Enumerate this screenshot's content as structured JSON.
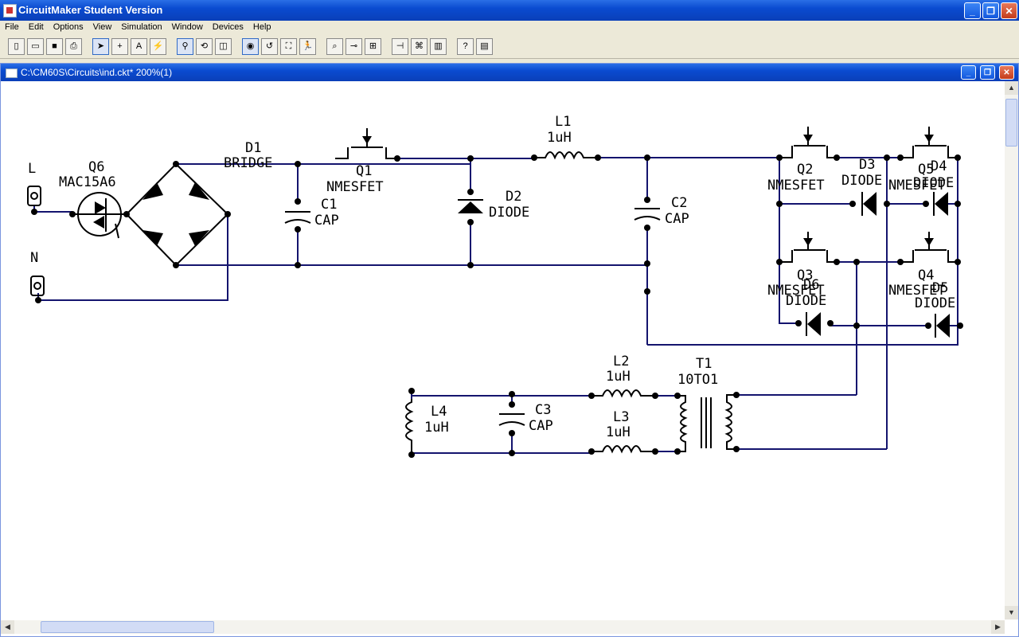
{
  "app": {
    "title": "CircuitMaker Student Version"
  },
  "menu": [
    "File",
    "Edit",
    "Options",
    "View",
    "Simulation",
    "Window",
    "Devices",
    "Help"
  ],
  "toolbar": {
    "icons": [
      "new-file-icon",
      "open-folder-icon",
      "save-icon",
      "print-icon",
      "arrow-tool-icon",
      "wire-tool-icon",
      "text-tool-icon",
      "probe-tool-icon",
      "zoom-icon",
      "rotate-icon",
      "mirror-icon",
      "simulate-icon",
      "undo-icon",
      "step-icon",
      "run-icon",
      "probe-icon",
      "scope-icon",
      "graph-icon",
      "component-icon",
      "search-icon",
      "paste-icon",
      "help-icon",
      "settings-icon"
    ]
  },
  "document": {
    "title": "C:\\CM60S\\Circuits\\ind.ckt* 200%(1)"
  },
  "schematic": {
    "labels": {
      "L": "L",
      "N": "N",
      "Q6_name": "Q6",
      "Q6_part": "MAC15A6",
      "D1_name": "D1",
      "D1_part": "BRIDGE",
      "C1_name": "C1",
      "C1_part": "CAP",
      "Q1_name": "Q1",
      "Q1_part": "NMESFET",
      "D2_name": "D2",
      "D2_part": "DIODE",
      "L1_name": "L1",
      "L1_val": "1uH",
      "C2_name": "C2",
      "C2_part": "CAP",
      "Q2_name": "Q2",
      "Q2_part": "NMESFET",
      "D3_name": "D3",
      "D3_part": "DIODE",
      "Q5_name": "Q5",
      "Q5_part": "NMESFET",
      "D4_name": "D4",
      "D4_part": "DIODE",
      "Q3_name": "Q3",
      "Q3_part": "NMESFET",
      "D6_name": "D6",
      "D6_part": "DIODE",
      "Q4_name": "Q4",
      "Q4_part": "NMESFET",
      "D5_name": "D5",
      "D5_part": "DIODE",
      "L2_name": "L2",
      "L2_val": "1uH",
      "L3_name": "L3",
      "L3_val": "1uH",
      "L4_name": "L4",
      "L4_val": "1uH",
      "C3_name": "C3",
      "C3_part": "CAP",
      "T1_name": "T1",
      "T1_part": "10TO1"
    }
  },
  "colors": {
    "wire": "#14146e",
    "titlebar": "#0a4bd0"
  }
}
